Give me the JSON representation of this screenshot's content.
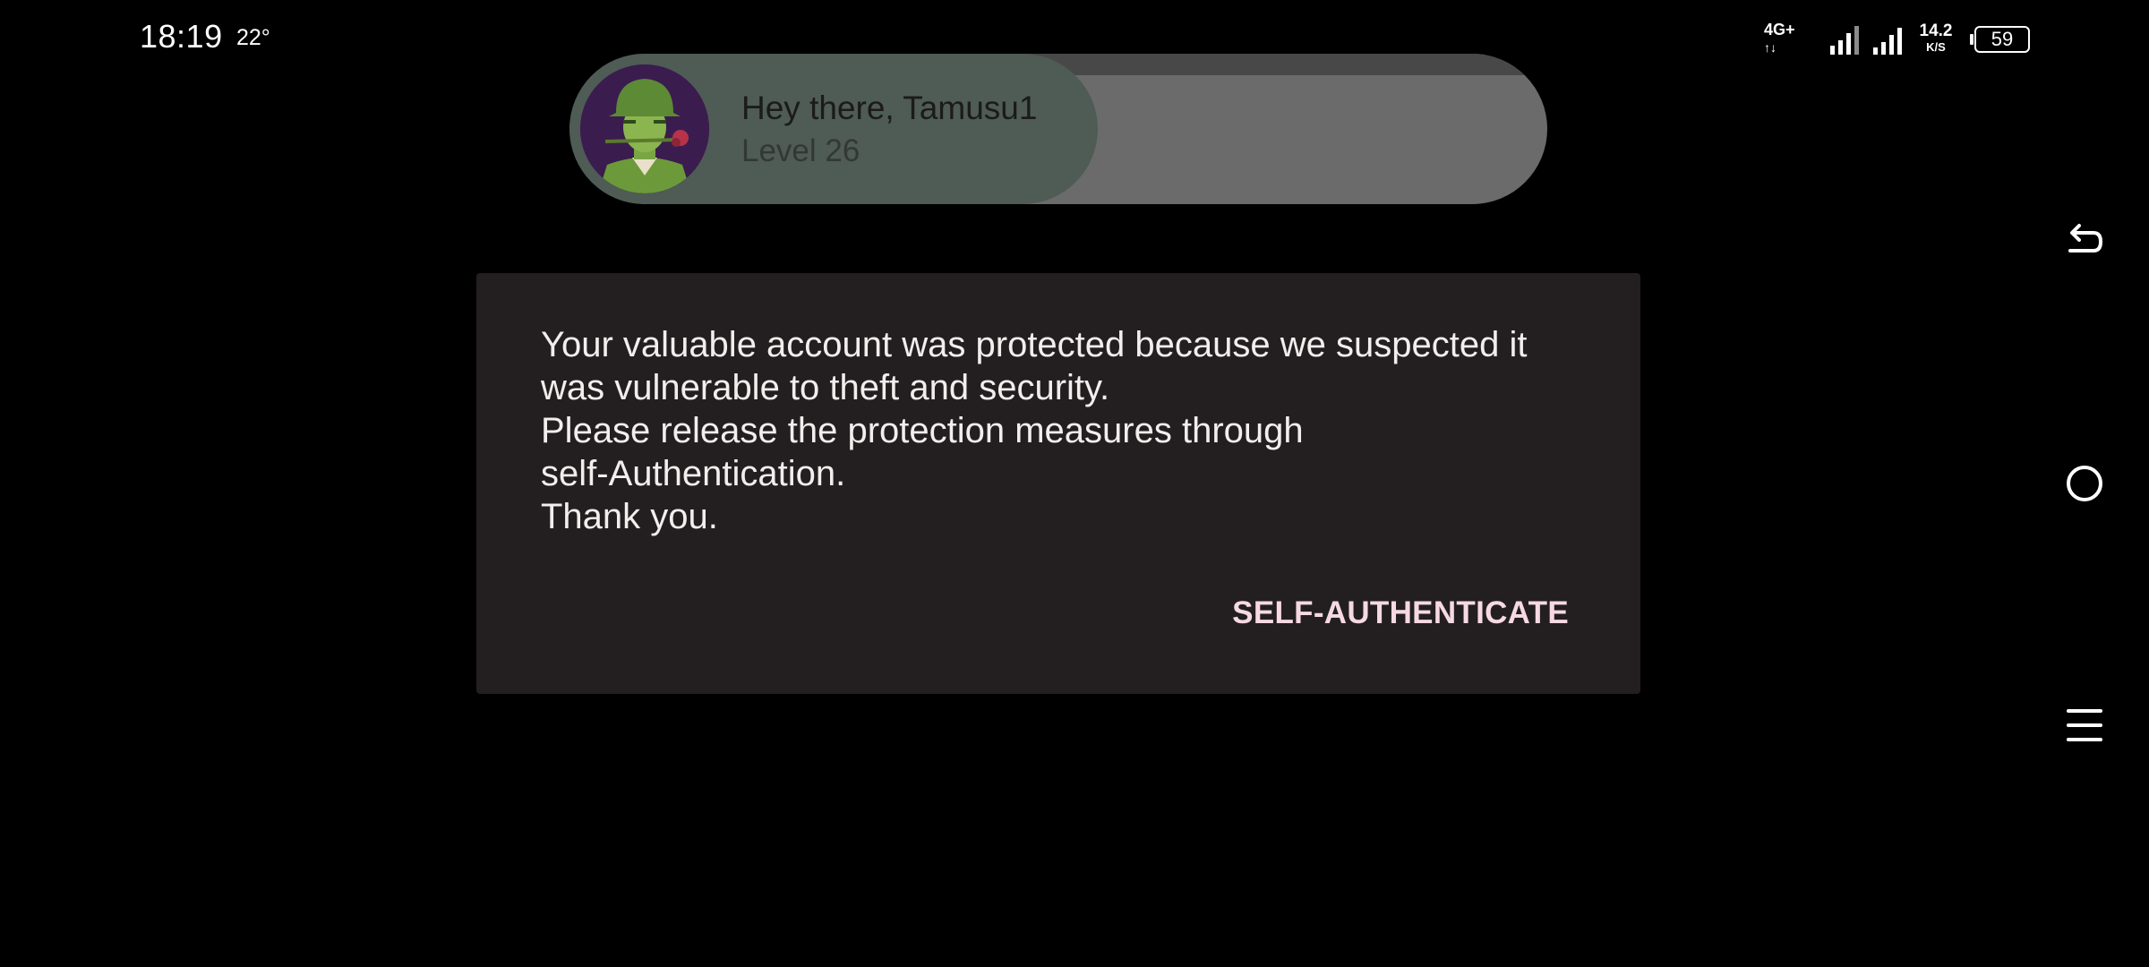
{
  "status_bar": {
    "time": "18:19",
    "temperature": "22°",
    "network_type": "4G+",
    "data_arrows": "↑↓",
    "speed_value": "14.2",
    "speed_unit": "K/S",
    "battery": "59"
  },
  "profile": {
    "greeting": "Hey there, Tamusu1",
    "level": "Level 26",
    "avatar_icon": "soldier-with-rose-avatar"
  },
  "dialog": {
    "message_lines": [
      "Your valuable account was protected because we suspected it",
      "was vulnerable to theft and security.",
      "Please release the protection measures through",
      "self-Authentication.",
      "Thank you."
    ],
    "button_label": "SELF-AUTHENTICATE"
  },
  "nav": {
    "back_icon": "back-arrow-icon",
    "home_icon": "home-circle-icon",
    "menu_icon": "menu-lines-icon"
  },
  "colors": {
    "background": "#000000",
    "dialog_bg": "#231f20",
    "button_text": "#f6d9e3",
    "pill_bg": "#6b6b6b"
  }
}
